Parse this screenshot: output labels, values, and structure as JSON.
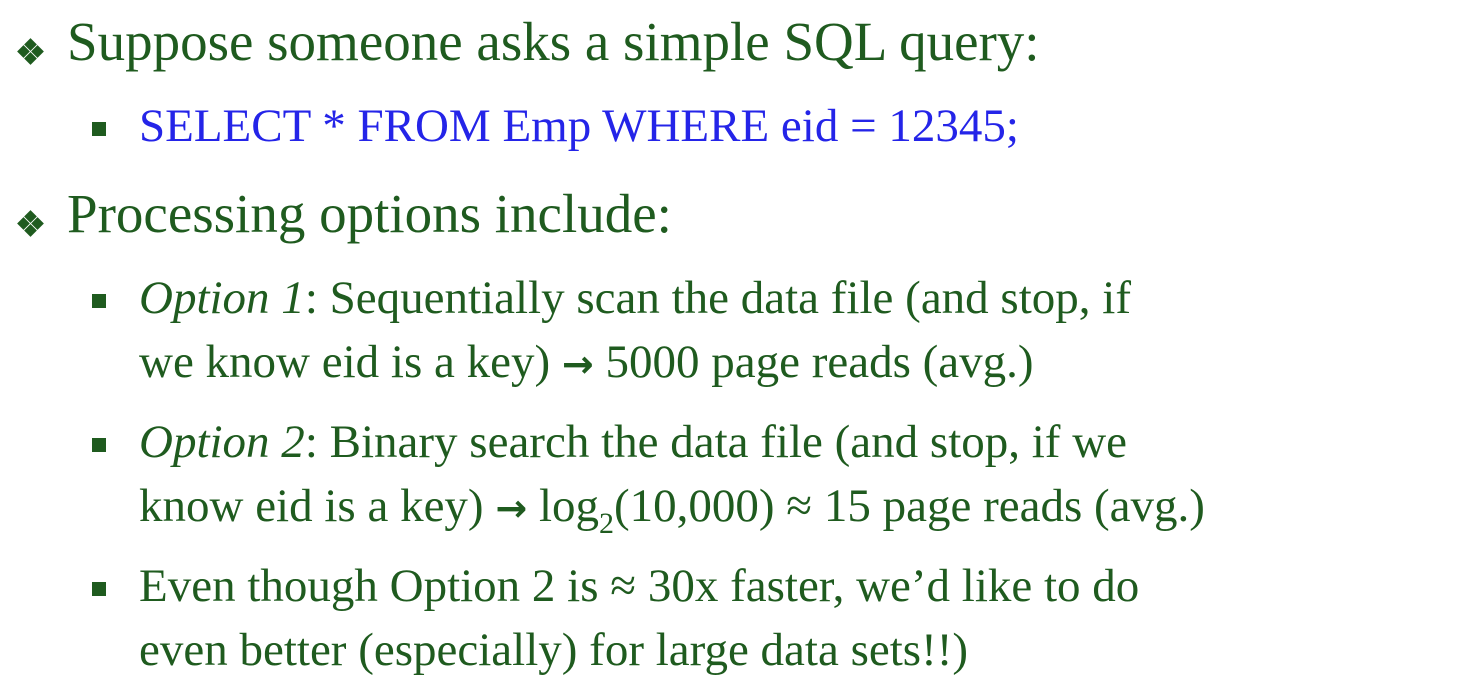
{
  "bullets": [
    {
      "text": "Suppose someone asks a simple SQL query:",
      "children": [
        {
          "text": "SELECT * FROM Emp WHERE eid = 12345;"
        }
      ]
    },
    {
      "text": "Processing options include:",
      "children": [
        {
          "option_label": "Option 1",
          "line1": ":  Sequentially scan the data file (and stop, if",
          "line2a": "we know eid is a key) ",
          "arrow": "→",
          "line2b": " 5000 page reads (avg.)"
        },
        {
          "option_label": "Option 2",
          "line1": ":  Binary search the data file (and stop, if we",
          "line2a": "know eid is a key) ",
          "arrow": "→",
          "line2b": " log",
          "subscript": "2",
          "line2c": "(10,000) ≈ 15 page reads (avg.)"
        },
        {
          "line1": "Even though Option 2 is ≈ 30x faster, we’d like to do",
          "line2": "even better (especially) for large data sets!!)"
        }
      ]
    }
  ]
}
